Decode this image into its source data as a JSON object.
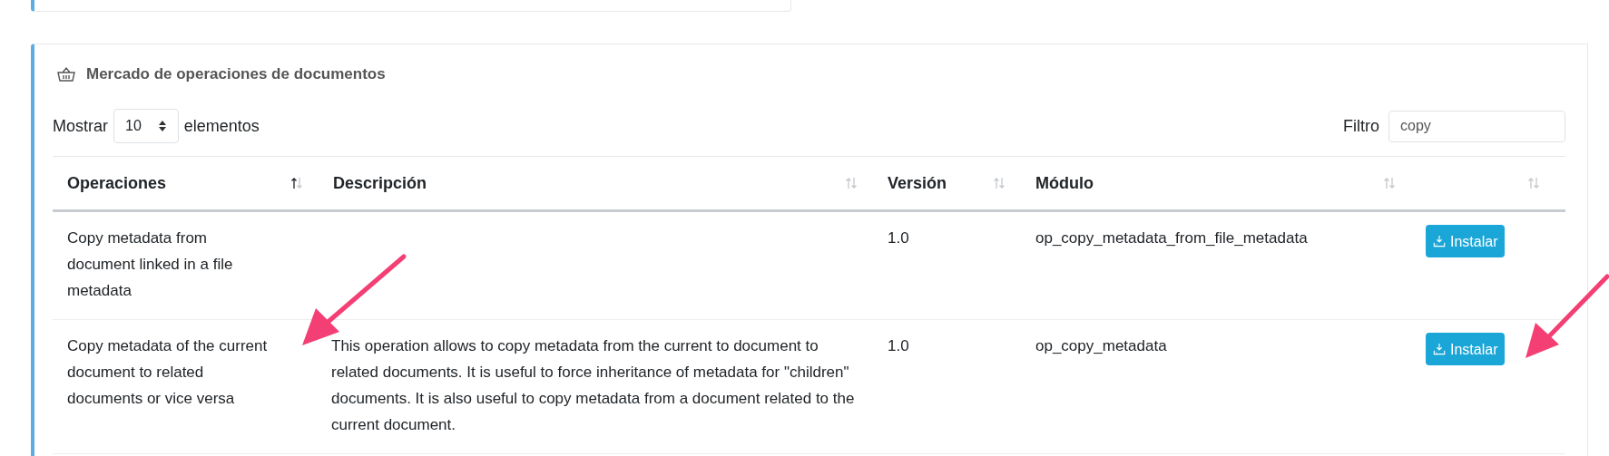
{
  "panel": {
    "title": "Mercado de operaciones de documentos"
  },
  "length_control": {
    "before": "Mostrar",
    "value": "10",
    "after": "elementos"
  },
  "filter": {
    "label": "Filtro",
    "value": "copy"
  },
  "table": {
    "columns": [
      {
        "label": "Operaciones",
        "sorted": true
      },
      {
        "label": "Descripción",
        "sorted": false
      },
      {
        "label": "Versión",
        "sorted": false
      },
      {
        "label": "Módulo",
        "sorted": false
      },
      {
        "sorted": false
      }
    ],
    "rows": [
      {
        "operation": "Copy metadata from document linked in a file metadata",
        "version": "1.0",
        "module": "op_copy_metadata_from_file_metadata",
        "action": "Instalar"
      },
      {
        "operation": "Copy metadata of the current document to related documents or vice versa",
        "description": "This operation allows to copy metadata from the current to document to related documents. It is useful to force inheritance of metadata for \"children\" documents. It is also useful to copy metadata from a document related to the current document.",
        "version": "1.0",
        "module": "op_copy_metadata",
        "action": "Instalar"
      }
    ]
  }
}
